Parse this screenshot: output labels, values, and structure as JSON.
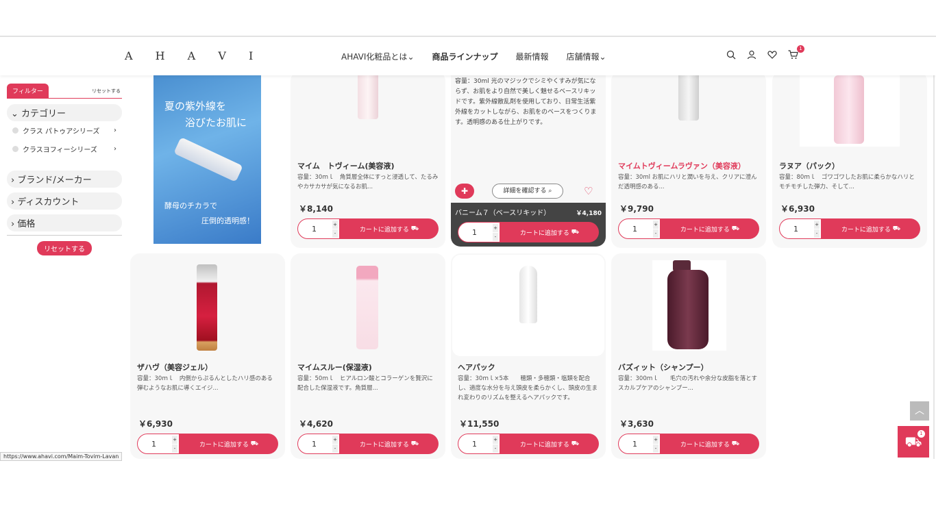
{
  "header": {
    "logo": "A H A V I",
    "nav": [
      "AHAVI化粧品とは",
      "商品ラインナップ",
      "最新情報",
      "店舗情報"
    ],
    "cart_count": "1"
  },
  "sidebar": {
    "filter_label": "フィルター",
    "reset_link": "リセットする",
    "category_head": "カテゴリー",
    "sub_items": [
      "クラス パトゥアシリーズ",
      "クラスヨフィーシリーズ"
    ],
    "groups": [
      "ブランド/メーカー",
      "ディスカウント",
      "価格"
    ],
    "reset_button": "リセットする"
  },
  "banner": {
    "line1": "夏の紫外線を",
    "line2": "浴びたお肌に",
    "line3": "酵母のチカラで",
    "line4": "圧倒的透明感！"
  },
  "add_to_cart": "カートに追加する",
  "qty": "1",
  "products_row1": [
    {
      "name": "マイム　トヴィーム(美容液)",
      "desc": "容量：30ｍｌ　角質層全体にすっと浸透して、たるみやカサカサが気になるお肌...",
      "price": "￥8,140"
    },
    {
      "name": "マイムトヴィームラヴァン（美容液）",
      "desc": "容量：30ml お肌にハリと潤いを与え、クリアに澄んだ透明感のある...",
      "price": "￥9,790"
    },
    {
      "name": "ラヌア（パック）",
      "desc": "容量：80ｍｌ　ゴワゴワしたお肌に柔らかなハリとモチモチした弾力、そして...",
      "price": "￥6,930"
    }
  ],
  "hover_card": {
    "desc": "容量：30ml 光のマジックでシミやくすみが気にならず、お肌をより自然で美しく魅せるベースリキッドです。紫外線散乱剤を使用しており、日常生活紫外線をカットしながら、お肌をのベースをつくります。透明感のある仕上がりです。",
    "detail": "詳細を確認する",
    "name": "バニーム７（ベースリキッド）",
    "price": "￥4,180"
  },
  "products_row2": [
    {
      "name": "ザハヴ（美容ジェル）",
      "desc": "容量：30ｍｌ　内側からぷるんとしたハリ感のある弾むようなお肌に導くエイジ...",
      "price": "￥6,930"
    },
    {
      "name": "マイムスルー(保湿液)",
      "desc": "容量：50ｍｌ　ヒアルロン酸とコラーゲンを贅沢に配合した保湿液です。角質層...",
      "price": "￥4,620"
    },
    {
      "name": "ヘアパック",
      "desc": "容量：30ｍｌ×5本　　穂類・多穂類・塩類を配合し、適度な水分を与え頭皮を柔らかくし、頭皮の生まれ変わりのリズムを整えるヘアパックです。",
      "price": "￥11,550"
    },
    {
      "name": "バズィット（シャンプー）",
      "desc": "容量：300ｍｌ　　毛穴の汚れや余分な皮脂を落とすスカルプケアのシャンプー...",
      "price": "￥3,630"
    }
  ],
  "floating_cart_count": "1",
  "status_url": "https://www.ahavi.com/Maim-Tovim-Lavan"
}
